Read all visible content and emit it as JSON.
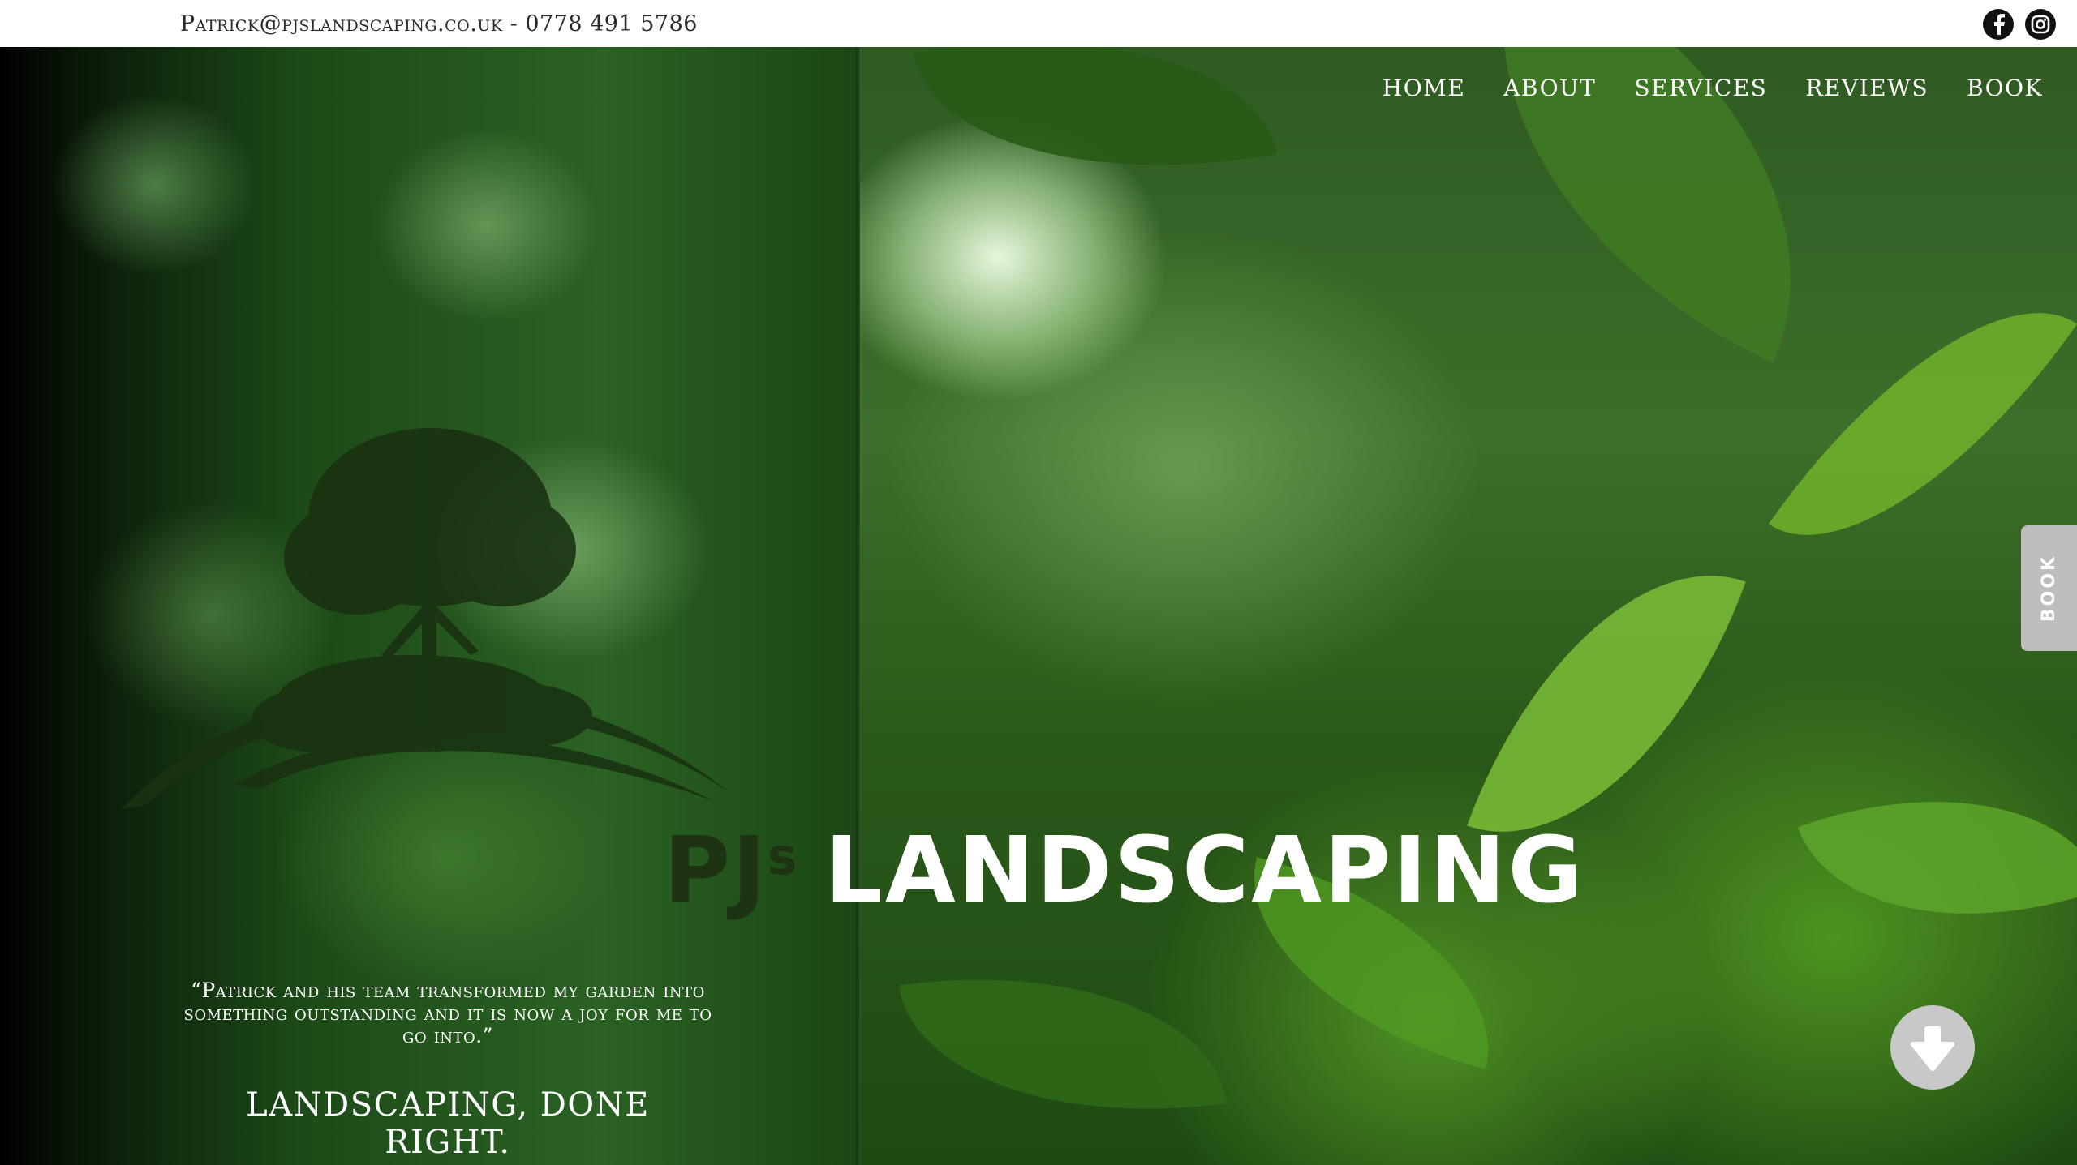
{
  "topbar": {
    "contact": "Patrick@pjslandscaping.co.uk - 0778 491 5786",
    "social": [
      {
        "icon": "facebook-icon"
      },
      {
        "icon": "instagram-icon"
      }
    ]
  },
  "nav": {
    "items": [
      "HOME",
      "ABOUT",
      "SERVICES",
      "REVIEWS",
      "BOOK"
    ]
  },
  "hero": {
    "title_pj": "PJ",
    "title_s": "s",
    "title_main": "LANDSCAPING",
    "quote": "“Patrick and his team transformed my garden into something outstanding and it is now a joy for me to go into.”",
    "tagline": "LANDSCAPING, DONE RIGHT."
  },
  "side_tab": {
    "label": "BOOK"
  },
  "scroll_button": {
    "icon": "arrow-down-icon"
  },
  "colors": {
    "topbar_bg": "#ffffff",
    "text_dark": "#2b2b2b",
    "accent_dark_green": "#1d3313",
    "button_grey": "#c8c8c8"
  }
}
